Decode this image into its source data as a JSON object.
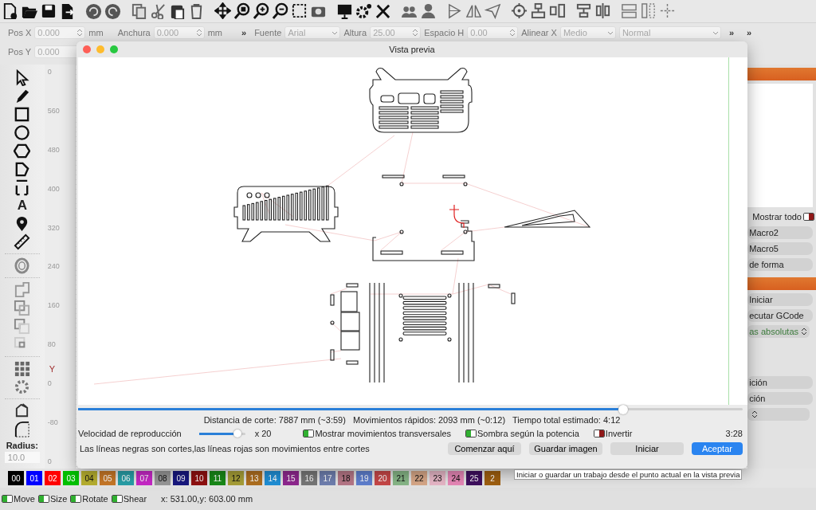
{
  "properties": {
    "row_1": [
      {
        "kind": "spin",
        "label": "Pos X",
        "value": "0.000",
        "unit": "mm"
      },
      {
        "kind": "spin",
        "label": "Anchura",
        "value": "0.000",
        "unit": "mm"
      },
      {
        "kind": "more",
        "label": "»"
      },
      {
        "kind": "dropdown",
        "label": "Fuente",
        "value": "Arial"
      },
      {
        "kind": "spin",
        "label": "Altura",
        "value": "25.00"
      },
      {
        "kind": "spin",
        "label": "Espacio H",
        "value": "0.00"
      },
      {
        "kind": "dropdown",
        "label": "Alinear X",
        "value": "Medio"
      },
      {
        "kind": "dropdown",
        "value": "Normal"
      },
      {
        "kind": "more",
        "label": "»"
      },
      {
        "kind": "more",
        "label": "»"
      }
    ],
    "row_2": [
      {
        "kind": "spin",
        "label": "Pos Y",
        "value": "0.000"
      }
    ]
  },
  "tools": {
    "text_tool": "A",
    "radius_label": "Radius:",
    "radius_value": "10.0"
  },
  "ruler": {
    "labels": [
      "0",
      "560",
      "480",
      "400",
      "320",
      "240",
      "160",
      "80",
      "0",
      "-80",
      "0"
    ],
    "axis_label": "Y"
  },
  "right_panel": [
    {
      "kind": "header"
    },
    {
      "kind": "box"
    },
    {
      "kind": "toggle",
      "label": "Mostrar todo",
      "on": false
    },
    {
      "kind": "button",
      "label": "Macro2"
    },
    {
      "kind": "button",
      "label": "Macro5"
    },
    {
      "kind": "button",
      "label": "de forma"
    },
    {
      "kind": "header"
    },
    {
      "kind": "button",
      "label": "Iniciar"
    },
    {
      "kind": "button",
      "label": "ecutar GCode"
    },
    {
      "kind": "dropdown",
      "label": "as absolutas"
    },
    {
      "kind": "space"
    },
    {
      "kind": "button",
      "label": "ición"
    },
    {
      "kind": "button",
      "label": "ción"
    },
    {
      "kind": "dropdown"
    }
  ],
  "dialog": {
    "title": "Vista previa",
    "progress": {
      "level": 0.82
    },
    "stats": "Distancia de corte: 7887 mm (~3:59)   Movimientos rápidos: 2093 mm (~0:12)   Tiempo total estimado: 4:12",
    "speed": {
      "label": "Velocidad de reproducción",
      "level": 0.83,
      "reading": "x 20"
    },
    "options": [
      {
        "label": "Mostrar movimientos transversales",
        "checked": true
      },
      {
        "label": "Sombra según la potencia",
        "checked": true
      },
      {
        "label": "Invertir",
        "checked": false
      }
    ],
    "time": "3:28",
    "legend": "Las líneas negras son cortes,las líneas rojas son movimientos entre cortes",
    "buttons": [
      {
        "label": "Comenzar aquí",
        "primary": false
      },
      {
        "label": "Guardar imagen",
        "primary": false
      },
      {
        "label": "Iniciar",
        "primary": false
      },
      {
        "label": "Aceptar",
        "primary": true
      }
    ]
  },
  "palette": [
    {
      "label": "00",
      "color": "#000000"
    },
    {
      "label": "01",
      "color": "#0000ff"
    },
    {
      "label": "02",
      "color": "#ff0000"
    },
    {
      "label": "03",
      "color": "#00c000"
    },
    {
      "label": "04",
      "color": "#b8b030"
    },
    {
      "label": "05",
      "color": "#c87828"
    },
    {
      "label": "06",
      "color": "#28a0a8"
    },
    {
      "label": "07",
      "color": "#c828c8"
    },
    {
      "label": "08",
      "color": "#989898"
    },
    {
      "label": "09",
      "color": "#181880"
    },
    {
      "label": "10",
      "color": "#901010"
    },
    {
      "label": "11",
      "color": "#188a18"
    },
    {
      "label": "12",
      "color": "#a8a038"
    },
    {
      "label": "13",
      "color": "#b07020"
    },
    {
      "label": "14",
      "color": "#2090d8"
    },
    {
      "label": "15",
      "color": "#902890"
    },
    {
      "label": "16",
      "color": "#787878"
    },
    {
      "label": "17",
      "color": "#7080b0"
    },
    {
      "label": "18",
      "color": "#b87888"
    },
    {
      "label": "19",
      "color": "#6080d0"
    },
    {
      "label": "20",
      "color": "#c84848"
    },
    {
      "label": "21",
      "color": "#88b888"
    },
    {
      "label": "22",
      "color": "#d8a888"
    },
    {
      "label": "23",
      "color": "#e8b8c8"
    },
    {
      "label": "24",
      "color": "#e888b8"
    },
    {
      "label": "25",
      "color": "#401060"
    },
    {
      "label": "2",
      "color": "#a06010"
    }
  ],
  "tooltip": "Iniciar o guardar un trabajo desde el punto actual en la vista previa",
  "status_bar": {
    "toggles": [
      {
        "label": "Move",
        "on": true
      },
      {
        "label": "Size",
        "on": true
      },
      {
        "label": "Rotate",
        "on": true
      },
      {
        "label": "Shear",
        "on": true
      }
    ],
    "coordinates": "x: 531.00,y: 603.00 mm"
  }
}
